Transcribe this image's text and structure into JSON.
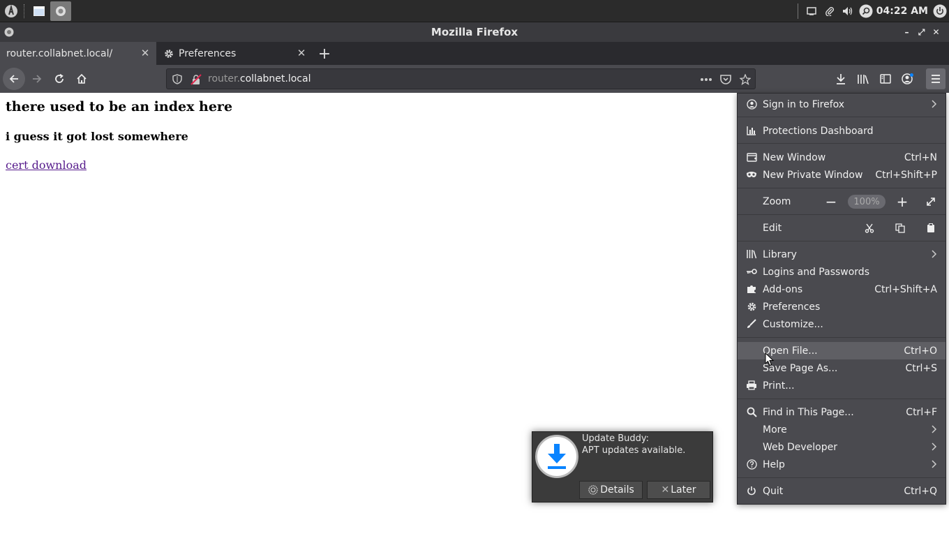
{
  "taskbar": {
    "clock": "04:22 AM",
    "icons": [
      "app-menu-icon",
      "show-desktop-icon",
      "firefox-icon",
      "window-icon",
      "paperclip-icon",
      "volume-icon",
      "search-icon",
      "power-icon"
    ]
  },
  "window": {
    "title": "Mozilla Firefox"
  },
  "tabs": [
    {
      "label": "router.collabnet.local/",
      "selected": true
    },
    {
      "label": "Preferences",
      "selected": false
    }
  ],
  "urlbar": {
    "subdomain": "router.",
    "domain": "collabnet.local"
  },
  "page": {
    "heading": "there used to be an index here",
    "subheading": "i guess it got lost somewhere",
    "link": "cert download"
  },
  "menu": {
    "sign_in": "Sign in to Firefox",
    "protections": "Protections Dashboard",
    "new_window": {
      "label": "New Window",
      "key": "Ctrl+N"
    },
    "new_private": {
      "label": "New Private Window",
      "key": "Ctrl+Shift+P"
    },
    "zoom": {
      "label": "Zoom",
      "minus": "−",
      "value": "100%",
      "plus": "+"
    },
    "edit": {
      "label": "Edit"
    },
    "library": "Library",
    "logins": "Logins and Passwords",
    "addons": {
      "label": "Add-ons",
      "key": "Ctrl+Shift+A"
    },
    "preferences": "Preferences",
    "customize": "Customize...",
    "open_file": {
      "label": "Open File...",
      "key": "Ctrl+O"
    },
    "save_page": {
      "label": "Save Page As...",
      "key": "Ctrl+S"
    },
    "print": "Print...",
    "find": {
      "label": "Find in This Page...",
      "key": "Ctrl+F"
    },
    "more": "More",
    "web_dev": "Web Developer",
    "help": "Help",
    "quit": {
      "label": "Quit",
      "key": "Ctrl+Q"
    }
  },
  "notification": {
    "title": "Update Buddy:",
    "body": "APT updates available.",
    "details": "Details",
    "later": "Later"
  },
  "colors": {
    "toolbar": "#4a4a4f",
    "tabbar": "#2a2a2e",
    "menu_bg": "#4a4a4f",
    "link": "#551a8b",
    "accent_blue": "#0a84ff"
  }
}
